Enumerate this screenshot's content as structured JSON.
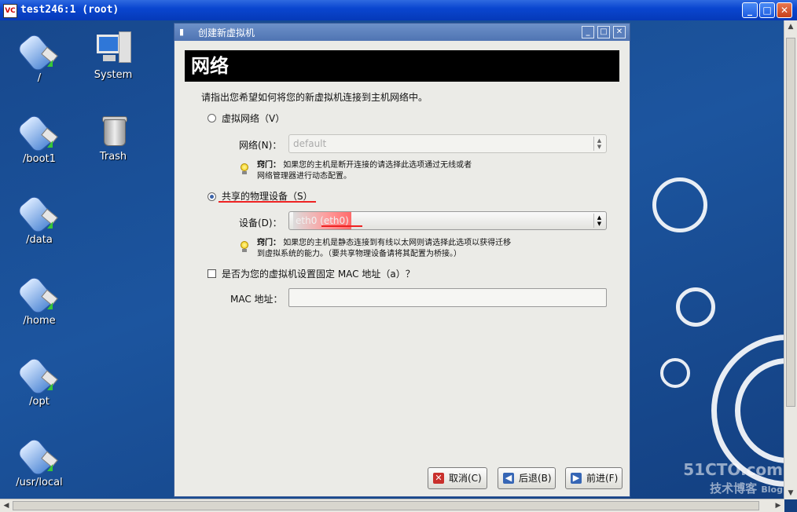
{
  "vnc": {
    "title": "test246:1 (root)",
    "icon_text": "VC",
    "minimize": "_",
    "maximize": "□",
    "close": "✕"
  },
  "desktop": {
    "icons": [
      {
        "label": "/"
      },
      {
        "label": "/boot1"
      },
      {
        "label": "/data"
      },
      {
        "label": "/home"
      },
      {
        "label": "/opt"
      },
      {
        "label": "/usr/local"
      },
      {
        "label": "System"
      },
      {
        "label": "Trash"
      }
    ]
  },
  "dialog": {
    "title": "创建新虚拟机",
    "banner": "网络",
    "prompt": "请指出您希望如何将您的新虚拟机连接到主机网络中。",
    "virtual_network_option": "虚拟网络（V）",
    "network_label": "网络(N)：",
    "network_value": "default",
    "tip1_prefix": "窍门：",
    "tip1_line1": "如果您的主机是断开连接的请选择此选项通过无线或者",
    "tip1_line2": "网络管理器进行动态配置。",
    "shared_device_option": "共享的物理设备（S）",
    "device_label": "设备(D)：",
    "device_value": "eth0 (eth0)",
    "tip2_prefix": "窍门：",
    "tip2_line1": "如果您的主机是静态连接到有线以太网则请选择此选项以获得迁移",
    "tip2_line2": "到虚拟系统的能力。（要共享物理设备请将其配置为桥接。）",
    "mac_checkbox": "是否为您的虚拟机设置固定 MAC 地址（a）？",
    "mac_label": "MAC 地址：",
    "mac_value": "",
    "cancel": "取消(C)",
    "back": "后退(B)",
    "forward": "前进(F)",
    "selected_option": "shared_device",
    "mac_checked": false
  },
  "watermark": {
    "line1": "51CTO.com",
    "line2": "技术博客",
    "line3": "Blog"
  },
  "colors": {
    "banner_bg": "#000000",
    "dialog_titlebar": "#5a7fbd",
    "annotation_red": "#e22222"
  }
}
